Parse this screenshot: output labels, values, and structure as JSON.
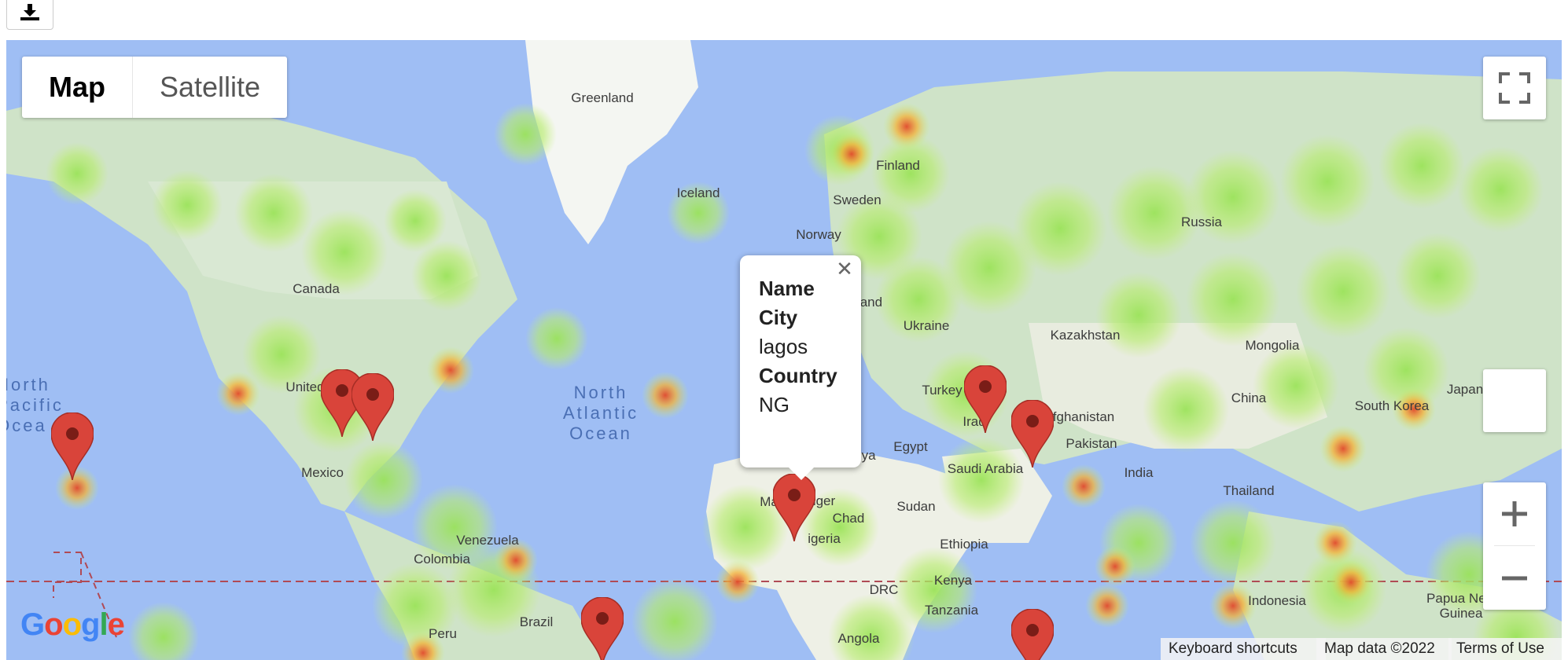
{
  "download": {
    "icon": "download-icon"
  },
  "map_type": {
    "map_label": "Map",
    "satellite_label": "Satellite",
    "selected": "Map"
  },
  "labels": {
    "greenland": "Greenland",
    "iceland": "Iceland",
    "finland": "Finland",
    "sweden": "Sweden",
    "norway": "Norway",
    "russia": "Russia",
    "canada": "Canada",
    "united": "United",
    "mexico": "Mexico",
    "kazakhstan": "Kazakhstan",
    "mongolia": "Mongolia",
    "ukraine": "Ukraine",
    "land": "land",
    "turkey": "Turkey",
    "iraq": "Iraq",
    "afghanistan": "fghanistan",
    "ir": "Ir",
    "pakistan": "Pakistan",
    "china": "China",
    "south_korea": "South Korea",
    "japan": "Japan",
    "india": "India",
    "egypt": "Egypt",
    "libya": "ibya",
    "saudi_arabia": "Saudi Arabia",
    "sudan": "Sudan",
    "chad": "Chad",
    "niger": "iger",
    "mali": "Ma",
    "nigeria": "igeria",
    "ethiopia": "Ethiopia",
    "kenya": "Kenya",
    "drc": "DRC",
    "tanzania": "Tanzania",
    "angola": "Angola",
    "thailand": "Thailand",
    "indonesia": "Indonesia",
    "papua": "Papua New\nGuinea",
    "venezuela": "Venezuela",
    "colombia": "Colombia",
    "brazil": "Brazil",
    "peru": "Peru",
    "north_atlantic": "North\nAtlantic\nOcean",
    "north_pacific": "North\nPacific\nOcea"
  },
  "info_window": {
    "name_heading": "Name",
    "city_heading": "City",
    "city_value": "lagos",
    "country_heading": "Country",
    "country_value": "NG"
  },
  "attribution": {
    "keyboard": "Keyboard shortcuts",
    "map_data": "Map data ©2022",
    "terms": "Terms of Use"
  },
  "logo": {
    "text": "Google"
  },
  "colors": {
    "water": "#9fbef4",
    "land": "#cfe3c8",
    "marker": "#d9443a",
    "heat_low": "#7ed957",
    "heat_high": "#e8492c"
  }
}
